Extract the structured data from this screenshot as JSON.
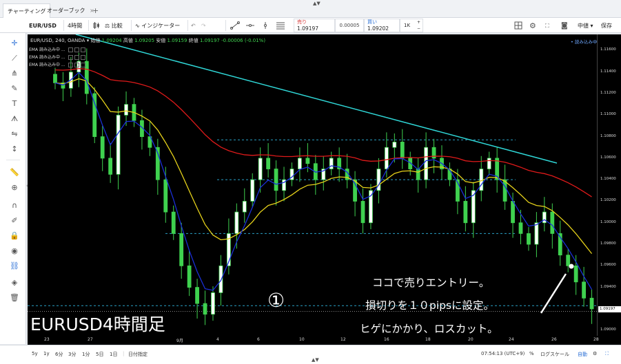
{
  "tabs": [
    {
      "label": "チャーティング",
      "close": ""
    },
    {
      "label": "オーダーブック",
      "close": "×"
    }
  ],
  "tab_add": "+",
  "toolbar": {
    "symbol": "EUR/USD",
    "interval": "4時間",
    "compare": "比較",
    "indicators": "インジケーター",
    "sell_label": "売り",
    "sell_value": "1.09197",
    "spread": "0.00005",
    "buy_label": "買い",
    "buy_value": "1.09202",
    "qty": "1K",
    "layout_label": "中値",
    "save_label": "保存"
  },
  "legend": {
    "title": "EUR/USD, 240, OANDA",
    "open_label": "始値",
    "open": "1.09204",
    "high_label": "高値",
    "high": "1.09205",
    "low_label": "安値",
    "low": "1.09159",
    "close_label": "終値",
    "close": "1.09197",
    "change": "-0.00006 (-0.01%)"
  },
  "ema_rows": [
    "EMA 読み込み中 ...",
    "EMA 読み込み中 ...",
    "EMA 読み込み中 ..."
  ],
  "loading_text": "• 読み込み中",
  "price_scale": {
    "labels": [
      "1.11600",
      "1.11400",
      "1.11200",
      "1.11000",
      "1.10800",
      "1.10600",
      "1.10400",
      "1.10200",
      "1.10000",
      "1.09800",
      "1.09600",
      "1.09400",
      "1.09197",
      "1.09000"
    ],
    "current": "1.09197"
  },
  "time_scale": [
    "23",
    "27",
    "9月",
    "4",
    "6",
    "10",
    "12",
    "16",
    "18",
    "20",
    "24",
    "26",
    "28"
  ],
  "annotations": {
    "line1": "ココで売りエントリー。",
    "line2": "損切りを１０pipsに設定。",
    "line3": "ヒゲにかかり、ロスカット。",
    "title": "EURUSD4時間足",
    "marker": "①"
  },
  "bottom": {
    "ranges": [
      "5y",
      "1y",
      "6分",
      "3分",
      "1分",
      "5日",
      "1日"
    ],
    "date_range": "日付指定",
    "time": "07:54:13 (UTC+9)",
    "percent": "%",
    "log": "ログスケール",
    "auto": "自動"
  },
  "colors": {
    "ema_fast": "#1a2fd6",
    "ema_mid": "#e6d21a",
    "ema_slow": "#e01a1a",
    "trendline": "#2fd6d6",
    "candle": "#3fd14f",
    "hline": "#2aa3c9"
  },
  "chart_data": {
    "type": "candlestick",
    "symbol": "EUR/USD",
    "interval": "240",
    "ylim": [
      1.0895,
      1.1175
    ],
    "x_labels": [
      "23",
      "27",
      "9月",
      "4",
      "6",
      "10",
      "12",
      "16",
      "18",
      "20",
      "24",
      "26",
      "28"
    ],
    "ohlc_close": [
      1.113,
      1.1125,
      1.114,
      1.115,
      1.112,
      1.108,
      1.106,
      1.1045,
      1.11,
      1.111,
      1.1095,
      1.108,
      1.107,
      1.104,
      1.101,
      1.099,
      1.096,
      1.094,
      1.0925,
      1.0915,
      1.0935,
      1.096,
      1.099,
      1.101,
      1.102,
      1.104,
      1.106,
      1.105,
      1.103,
      1.104,
      1.105,
      1.106,
      1.1055,
      1.104,
      1.105,
      1.106,
      1.105,
      1.104,
      1.102,
      1.1,
      1.103,
      1.105,
      1.107,
      1.1075,
      1.106,
      1.105,
      1.104,
      1.107,
      1.106,
      1.105,
      1.104,
      1.102,
      1.1,
      1.103,
      1.105,
      1.106,
      1.104,
      1.102,
      1.1,
      1.099,
      1.098,
      1.1,
      1.101,
      1.099,
      1.097,
      1.096,
      1.0945,
      1.093,
      1.092
    ],
    "ema_fast_close": 1.0935,
    "ema_mid_close": 1.098,
    "ema_slow_close": 1.1022,
    "h_levels": [
      1.1077,
      1.104,
      1.099,
      1.0923
    ],
    "last_price": 1.09197
  }
}
